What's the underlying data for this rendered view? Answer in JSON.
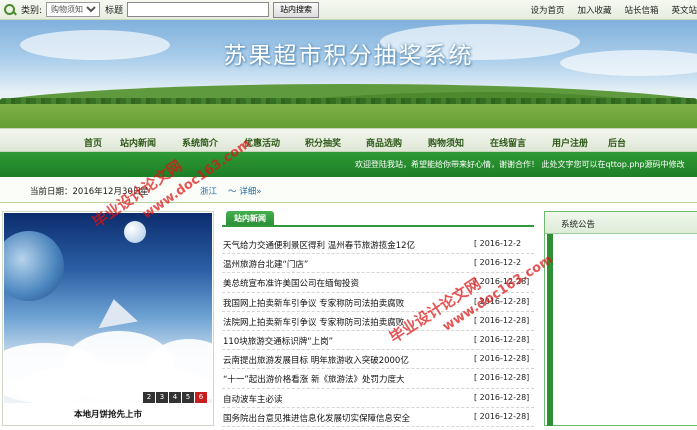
{
  "search": {
    "category_label": "类别:",
    "category_selected": "购物须知",
    "title_label": "标题",
    "title_value": "",
    "button_label": "站内搜索"
  },
  "top_links": [
    "设为首页",
    "加入收藏",
    "站长信箱",
    "英文站"
  ],
  "banner": {
    "title": "苏果超市积分抽奖系统"
  },
  "nav": [
    "首页",
    "站内新闻",
    "系统简介",
    "优惠活动",
    "积分抽奖",
    "商品选购",
    "购物须知",
    "在线留言",
    "用户注册",
    "后台"
  ],
  "marquee": "欢迎登陆我站，希望能给你带来好心情，谢谢合作！ 此处文字您可以在qttop.php源码中修改",
  "daterow": {
    "date": "当前日期：2016年12月30日",
    "weekday": "星",
    "place": "浙江",
    "detail": "～ 详细»"
  },
  "slideshow": {
    "caption": "本地月饼抢先上市",
    "pages": [
      "2",
      "3",
      "4",
      "5",
      "6"
    ],
    "active_page": "6"
  },
  "news": {
    "tab_label": "站内新闻",
    "items": [
      {
        "title": "天气给力交通便利景区得利 温州春节旅游揽金12亿",
        "date": "[ 2016-12-2"
      },
      {
        "title": "温州旅游台北建“门店”",
        "date": "[ 2016-12-2"
      },
      {
        "title": "美总统宣布准许美国公司在缅甸投资",
        "date": "[ 2016-12-28]"
      },
      {
        "title": "我国网上拍卖新车引争议 专家称防司法拍卖腐败",
        "date": "[ 2016-12-28]"
      },
      {
        "title": "法院网上拍卖新车引争议 专家称防司法拍卖腐败",
        "date": "[ 2016-12-28]"
      },
      {
        "title": "110块旅游交通标识牌“上岗”",
        "date": "[ 2016-12-28]"
      },
      {
        "title": "云南提出旅游发展目标 明年旅游收入突破2000亿",
        "date": "[ 2016-12-28]"
      },
      {
        "title": "“十一”起出游价格看涨 新《旅游法》处罚力度大",
        "date": "[ 2016-12-28]"
      },
      {
        "title": "自动波车主必读",
        "date": "[ 2016-12-28]"
      },
      {
        "title": "国务院出台意见推进信息化发展切实保障信息安全",
        "date": "[ 2016-12-28]"
      }
    ]
  },
  "notice": {
    "title": "系统公告"
  },
  "watermark": {
    "text_a": "毕业设计论文网",
    "text_b": "www.doc163.com"
  },
  "colors": {
    "nav_text": "#2f5a1a",
    "marquee_bg": "#1d7e26",
    "tab_green": "#2e9a3a",
    "watermark_red": "#dc1414"
  }
}
